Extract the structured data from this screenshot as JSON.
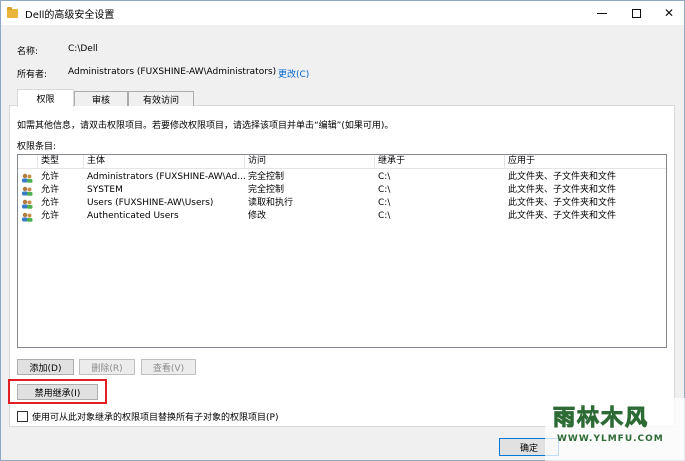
{
  "window": {
    "title": "Dell的高级安全设置",
    "close_glyph": "✕"
  },
  "info": {
    "name_label": "名称:",
    "name_value": "C:\\Dell",
    "owner_label": "所有者:",
    "owner_value": "Administrators (FUXSHINE-AW\\Administrators)",
    "change_link": "更改(C)"
  },
  "tabs": [
    "权限",
    "审核",
    "有效访问"
  ],
  "hint": "如需其他信息，请双击权限项目。若要修改权限项目，请选择该项目并单击“编辑”(如果可用)。",
  "entries_label": "权限条目:",
  "table": {
    "columns": [
      "类型",
      "主体",
      "访问",
      "继承于",
      "应用于"
    ],
    "rows": [
      {
        "type": "允许",
        "principal": "Administrators (FUXSHINE-AW\\Ad...",
        "access": "完全控制",
        "inherited": "C:\\",
        "applies": "此文件夹、子文件夹和文件"
      },
      {
        "type": "允许",
        "principal": "SYSTEM",
        "access": "完全控制",
        "inherited": "C:\\",
        "applies": "此文件夹、子文件夹和文件"
      },
      {
        "type": "允许",
        "principal": "Users (FUXSHINE-AW\\Users)",
        "access": "读取和执行",
        "inherited": "C:\\",
        "applies": "此文件夹、子文件夹和文件"
      },
      {
        "type": "允许",
        "principal": "Authenticated Users",
        "access": "修改",
        "inherited": "C:\\",
        "applies": "此文件夹、子文件夹和文件"
      }
    ]
  },
  "buttons": {
    "add": "添加(D)",
    "remove": "删除(R)",
    "view": "查看(V)",
    "disable_inheritance": "禁用继承(I)",
    "ok": "确定"
  },
  "replace_checkbox": "使用可从此对象继承的权限项目替换所有子对象的权限项目(P)",
  "watermark": {
    "title": "雨林木风",
    "url": "WWW.YLMFU.COM"
  },
  "colors": {
    "accent": "#0078d7",
    "highlight_border": "#e21e25",
    "link": "#0066cc"
  }
}
